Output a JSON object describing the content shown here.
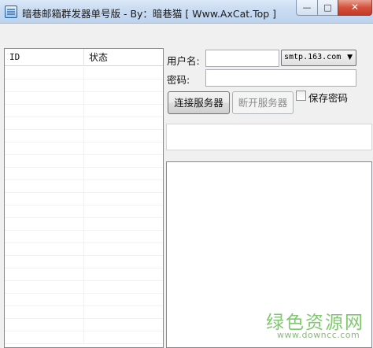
{
  "window": {
    "title": "暗巷邮箱群发器单号版 - By：暗巷猫 [ Www.AxCat.Top ]",
    "minimize_glyph": "—",
    "maximize_glyph": "□",
    "close_glyph": "✕"
  },
  "list": {
    "columns": [
      "ID",
      "状态"
    ],
    "row_count_visible": 22
  },
  "form": {
    "username_label": "用户名:",
    "username_value": "",
    "password_label": "密码:",
    "password_value": "",
    "server_selected": "smtp.163.com",
    "connect_button": "连接服务器",
    "disconnect_button": "断开服务器",
    "save_password_label": "保存密码",
    "save_password_checked": false
  },
  "status_text": "",
  "log_text": "",
  "watermark": {
    "main": "绿色资源网",
    "sub": "www.downcc.com"
  }
}
